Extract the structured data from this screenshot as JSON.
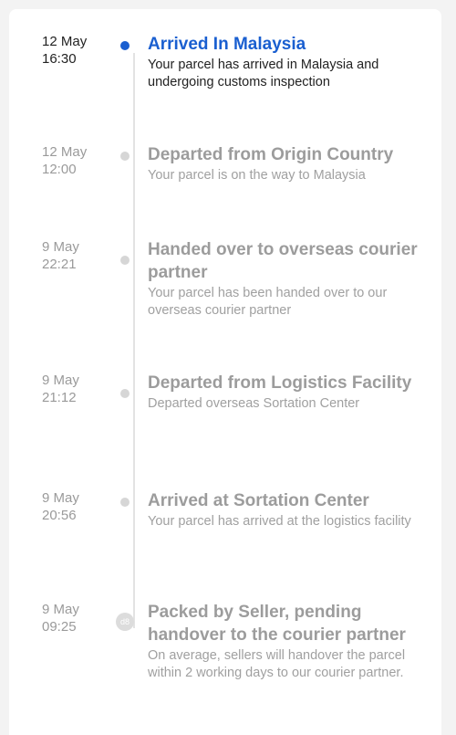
{
  "events": [
    {
      "date": "12 May",
      "time": "16:30",
      "title": "Arrived In Malaysia",
      "description": "Your parcel has arrived in Malaysia and undergoing customs inspection",
      "active": true
    },
    {
      "date": "12 May",
      "time": "12:00",
      "title": "Departed from Origin Country",
      "description": "Your parcel is on the way to Malaysia",
      "active": false
    },
    {
      "date": "9 May",
      "time": "22:21",
      "title": "Handed over to overseas courier partner",
      "description": "Your parcel has been handed over to our overseas courier partner",
      "active": false
    },
    {
      "date": "9 May",
      "time": "21:12",
      "title": "Departed from Logistics Facility",
      "description": "Departed overseas Sortation Center",
      "active": false
    },
    {
      "date": "9 May",
      "time": "20:56",
      "title": "Arrived at Sortation Center",
      "description": "Your parcel has arrived at the logistics facility",
      "active": false
    },
    {
      "date": "9 May",
      "time": "09:25",
      "title": "Packed by Seller, pending handover to the courier partner",
      "description": "On average, sellers will handover the parcel within 2 working days to our courier partner.",
      "active": false,
      "badge": "d8"
    }
  ],
  "colors": {
    "active": "#1a5fd0",
    "inactive": "#9c9c9c",
    "line": "#e3e3e3"
  }
}
